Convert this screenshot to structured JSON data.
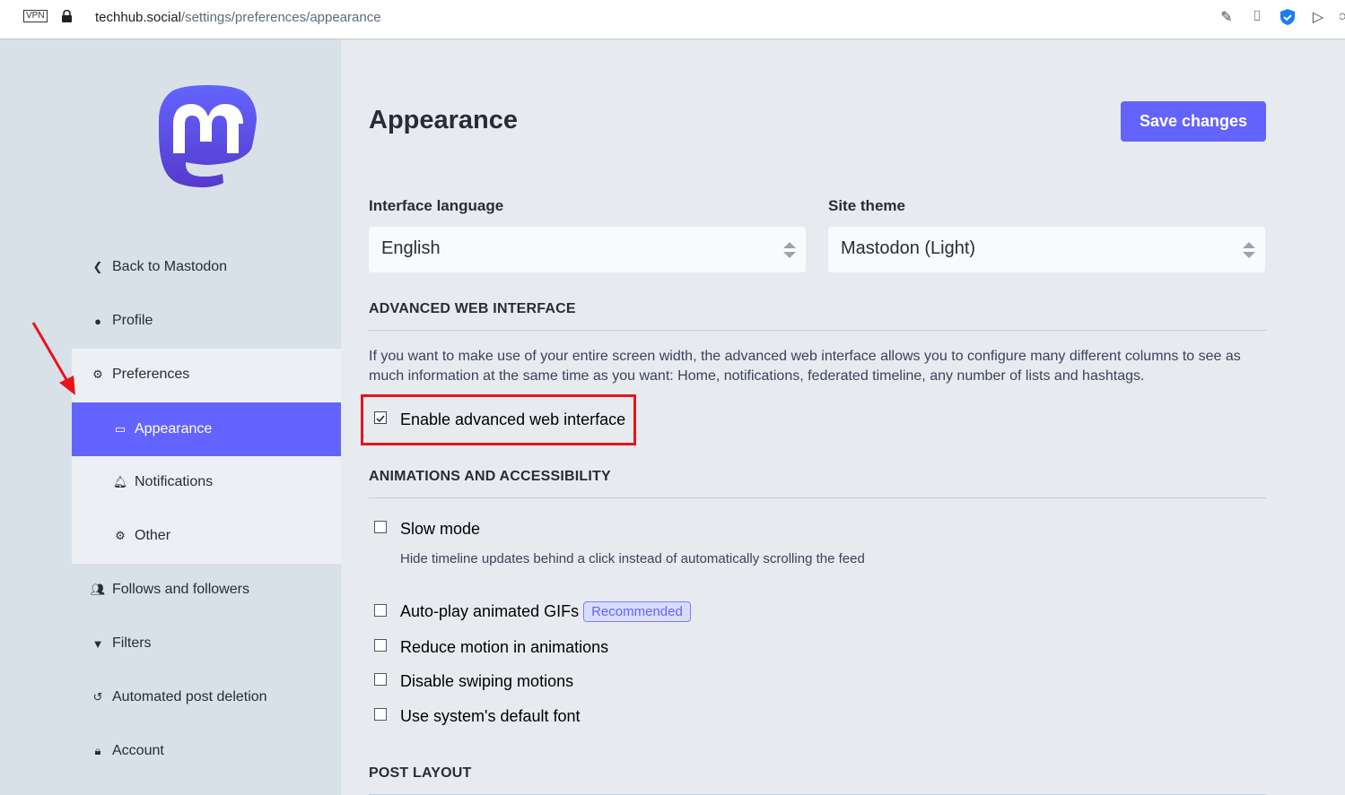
{
  "browser": {
    "vpn": "VPN",
    "url_host": "techhub.social",
    "url_path": "/settings/preferences/appearance"
  },
  "sidebar": {
    "items": [
      {
        "label": "Back to Mastodon",
        "icon": "chevron-left-icon"
      },
      {
        "label": "Profile",
        "icon": "user-icon"
      },
      {
        "label": "Preferences",
        "icon": "gear-icon"
      },
      {
        "label": "Appearance",
        "icon": "desktop-icon"
      },
      {
        "label": "Notifications",
        "icon": "bell-icon"
      },
      {
        "label": "Other",
        "icon": "gear-icon"
      },
      {
        "label": "Follows and followers",
        "icon": "users-icon"
      },
      {
        "label": "Filters",
        "icon": "filter-icon"
      },
      {
        "label": "Automated post deletion",
        "icon": "history-icon"
      },
      {
        "label": "Account",
        "icon": "lock-icon"
      }
    ],
    "active": "Appearance"
  },
  "main": {
    "title": "Appearance",
    "save_label": "Save changes",
    "language_label": "Interface language",
    "language_value": "English",
    "theme_label": "Site theme",
    "theme_value": "Mastodon (Light)",
    "advanced_heading": "ADVANCED WEB INTERFACE",
    "advanced_desc": "If you want to make use of your entire screen width, the advanced web interface allows you to configure many different columns to see as much information at the same time as you want: Home, notifications, federated timeline, any number of lists and hashtags.",
    "advanced_checkbox": {
      "label": "Enable advanced web interface",
      "checked": true
    },
    "anim_heading": "ANIMATIONS AND ACCESSIBILITY",
    "slow_mode": {
      "label": "Slow mode",
      "hint": "Hide timeline updates behind a click instead of automatically scrolling the feed",
      "checked": false
    },
    "autoplay": {
      "label": "Auto-play animated GIFs",
      "badge": "Recommended",
      "checked": false
    },
    "reduce_motion": {
      "label": "Reduce motion in animations",
      "checked": false
    },
    "disable_swipe": {
      "label": "Disable swiping motions",
      "checked": false
    },
    "system_font": {
      "label": "Use system's default font",
      "checked": false
    },
    "post_layout_heading": "POST LAYOUT"
  },
  "colors": {
    "accent": "#6364ff",
    "highlight": "#e8141b"
  }
}
